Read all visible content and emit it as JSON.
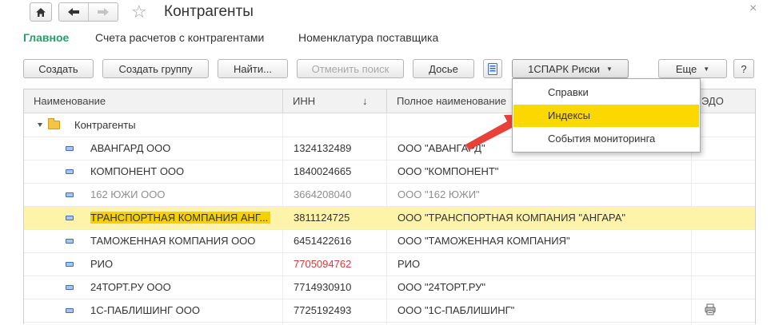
{
  "header": {
    "title": "Контрагенты",
    "home_icon": "home-icon",
    "back_icon": "arrow-left-icon",
    "forward_icon": "arrow-right-icon",
    "favorite_icon": "star-icon",
    "close_glyph": "×"
  },
  "sections": [
    {
      "label": "Главное",
      "active": true
    },
    {
      "label": "Счета расчетов с контрагентами",
      "active": false
    },
    {
      "label": "Номенклатура поставщика",
      "active": false
    }
  ],
  "toolbar": {
    "create": "Создать",
    "create_group": "Создать группу",
    "find": "Найти...",
    "cancel_search": "Отменить поиск",
    "dossier": "Досье",
    "spark": "1СПАРК Риски",
    "more": "Еще",
    "help": "?"
  },
  "table": {
    "columns": {
      "name": "Наименование",
      "inn": "ИНН",
      "sort_glyph": "↓",
      "full_name": "Полное наименование",
      "edo": "ЭДО"
    },
    "group_label": "Контрагенты",
    "rows": [
      {
        "name": "АВАНГАРД ООО",
        "inn": "1324132489",
        "full": "ООО  \"АВАНГАРД\""
      },
      {
        "name": "КОМПОНЕНТ ООО",
        "inn": "1840024665",
        "full": "ООО \"КОМПОНЕНТ\""
      },
      {
        "name": "162 ЮЖИ ООО",
        "inn": "3664208040",
        "full": "ООО \"162 ЮЖИ\""
      },
      {
        "name": "ТРАНСПОРТНАЯ КОМПАНИЯ АНГ...",
        "inn": "3811124725",
        "full": "ООО \"ТРАНСПОРТНАЯ КОМПАНИЯ \"АНГАРА\""
      },
      {
        "name": "ТАМОЖЕННАЯ КОМПАНИЯ ООО",
        "inn": "6451422616",
        "full": "ООО \"ТАМОЖЕННАЯ КОМПАНИЯ\""
      },
      {
        "name": "РИО",
        "inn": "7705094762",
        "full": "РИО"
      },
      {
        "name": "24ТОРТ.РУ ООО",
        "inn": "7714930910",
        "full": "ООО \"24ТОРТ.РУ\""
      },
      {
        "name": "1С-ПАБЛИШИНГ ООО",
        "inn": "7725192493",
        "full": "ООО \"1С-ПАБЛИШИНГ\""
      }
    ]
  },
  "dropdown": {
    "items": [
      "Справки",
      "Индексы",
      "События мониторинга"
    ],
    "highlighted": "Индексы"
  },
  "colors": {
    "accent_green": "#23a06b",
    "highlight_yellow": "#fbd800",
    "selected_row": "#fdf3a9",
    "arrow_red": "#e8413a",
    "inn_warning_red": "#d23c3c"
  }
}
